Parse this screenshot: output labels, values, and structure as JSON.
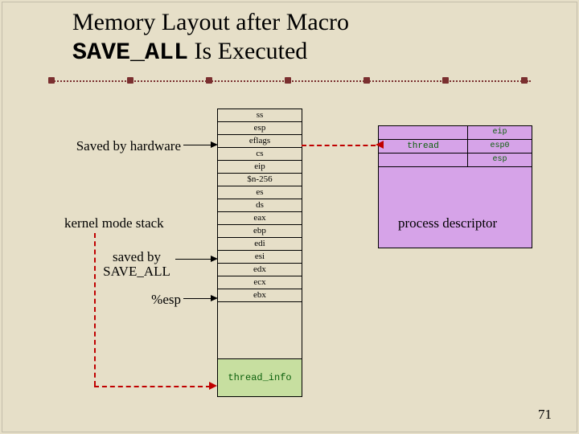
{
  "title_line1": "Memory Layout after Macro",
  "title_macro": "SAVE_ALL",
  "title_line2_rest": " Is Executed",
  "labels": {
    "saved_hw": "Saved by hardware",
    "kernel_stack": "kernel mode stack",
    "saved_by": "saved by",
    "save_all": "SAVE_ALL",
    "esp_ptr": "%esp",
    "proc_desc": "process descriptor"
  },
  "stack_rows": [
    "ss",
    "esp",
    "eflags",
    "cs",
    "eip",
    "$n-256",
    "es",
    "ds",
    "eax",
    "ebp",
    "edi",
    "esi",
    "edx",
    "ecx",
    "ebx"
  ],
  "thread_info": "thread_info",
  "pd": {
    "rows": [
      {
        "left": "",
        "right": "eip"
      },
      {
        "left": "thread",
        "right": "esp0"
      },
      {
        "left": "",
        "right": "esp"
      }
    ]
  },
  "slidenum": "71"
}
